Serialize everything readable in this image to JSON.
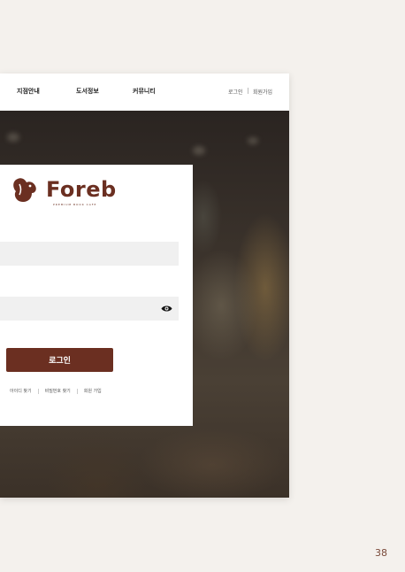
{
  "nav": {
    "items": [
      "지점안내",
      "도서정보",
      "커뮤니티"
    ],
    "login": "로그인",
    "signup": "회원가입"
  },
  "logo": {
    "name": "Foreb",
    "tagline": "PREMIUM BOOK CAFE"
  },
  "form": {
    "id_value": "",
    "password_value": "",
    "login_button": "로그인",
    "links": [
      "아이디 찾기",
      "비밀번호 찾기",
      "회원 가입"
    ]
  },
  "page_number": "38",
  "colors": {
    "brand": "#6b2f21",
    "background": "#f4f1ed"
  }
}
